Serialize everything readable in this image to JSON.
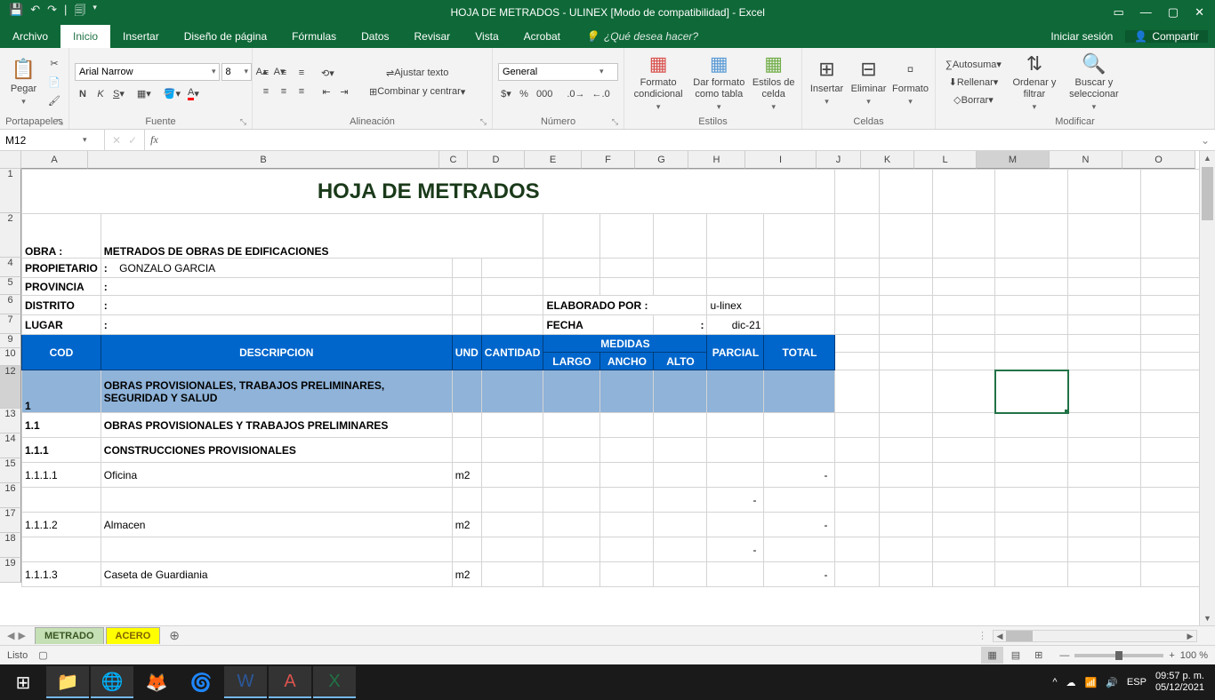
{
  "titlebar": {
    "title": "HOJA DE METRADOS - ULINEX  [Modo de compatibilidad] - Excel"
  },
  "tabs": {
    "file": "Archivo",
    "items": [
      "Inicio",
      "Insertar",
      "Diseño de página",
      "Fórmulas",
      "Datos",
      "Revisar",
      "Vista",
      "Acrobat"
    ],
    "tellme": "¿Qué desea hacer?",
    "signin": "Iniciar sesión",
    "share": "Compartir"
  },
  "ribbon": {
    "clipboard": {
      "paste": "Pegar",
      "label": "Portapapeles"
    },
    "font": {
      "name": "Arial Narrow",
      "size": "8",
      "label": "Fuente"
    },
    "align": {
      "wrap": "Ajustar texto",
      "merge": "Combinar y centrar",
      "label": "Alineación"
    },
    "number": {
      "format": "General",
      "label": "Número"
    },
    "styles": {
      "cond": "Formato condicional",
      "table": "Dar formato como tabla",
      "cell": "Estilos de celda",
      "label": "Estilos"
    },
    "cells": {
      "insert": "Insertar",
      "delete": "Eliminar",
      "format": "Formato",
      "label": "Celdas"
    },
    "editing": {
      "autosum": "Autosuma",
      "fill": "Rellenar",
      "clear": "Borrar",
      "sort": "Ordenar y filtrar",
      "find": "Buscar y seleccionar",
      "label": "Modificar"
    }
  },
  "fbar": {
    "cellref": "M12"
  },
  "cols": [
    "A",
    "B",
    "C",
    "D",
    "E",
    "F",
    "G",
    "H",
    "I",
    "J",
    "K",
    "L",
    "M",
    "N",
    "O"
  ],
  "rows": [
    "1",
    "2",
    "4",
    "5",
    "6",
    "7",
    "9",
    "10",
    "12",
    "13",
    "14",
    "15",
    "16",
    "17",
    "18",
    "19"
  ],
  "sheet": {
    "title": "HOJA DE METRADOS",
    "obra_lbl": "OBRA  :",
    "obra_val": "METRADOS DE OBRAS DE EDIFICACIONES",
    "prop_lbl": "PROPIETARIO",
    "colon": ":",
    "prop_val": "GONZALO GARCIA",
    "prov_lbl": "PROVINCIA",
    "dist_lbl": "DISTRITO",
    "elab_lbl": "ELABORADO POR :",
    "elab_val": "u-linex",
    "lugar_lbl": "LUGAR",
    "fecha_lbl": "FECHA",
    "fecha_val": "dic-21",
    "h_cod": "COD",
    "h_desc": "DESCRIPCION",
    "h_und": "UND",
    "h_cant": "CANTIDAD",
    "h_med": "MEDIDAS",
    "h_largo": "LARGO",
    "h_ancho": "ANCHO",
    "h_alto": "ALTO",
    "h_parcial": "PARCIAL",
    "h_total": "TOTAL",
    "r12_cod": "1",
    "r12_desc": "OBRAS PROVISIONALES, TRABAJOS PRELIMINARES, SEGURIDAD Y SALUD",
    "r13_cod": "1.1",
    "r13_desc": "OBRAS PROVISIONALES Y TRABAJOS PRELIMINARES",
    "r14_cod": "1.1.1",
    "r14_desc": "CONSTRUCCIONES PROVISIONALES",
    "r15_cod": "1.1.1.1",
    "r15_desc": "Oficina",
    "r15_und": "m2",
    "dash": "-",
    "r17_cod": "1.1.1.2",
    "r17_desc": "Almacen",
    "r17_und": "m2",
    "r19_cod": "1.1.1.3",
    "r19_desc": "Caseta de Guardiania",
    "r19_und": "m2"
  },
  "sheettabs": {
    "t1": "METRADO",
    "t2": "ACERO"
  },
  "status": {
    "ready": "Listo",
    "zoom": "100 %"
  },
  "taskbar": {
    "time": "09:57 p. m.",
    "date": "05/12/2021"
  }
}
